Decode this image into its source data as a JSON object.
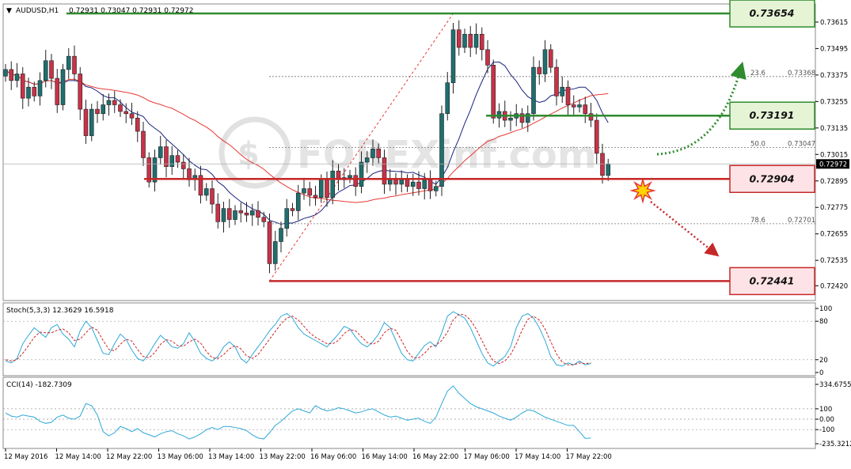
{
  "header": {
    "symbol_label": "AUDUSD,H1",
    "ohlc": "0.72931 0.73047 0.72931 0.72972"
  },
  "watermark": "FOREXinf.com",
  "colors": {
    "bull": "#1f6f6f",
    "bear": "#c83248",
    "ma_fast": "#1a237e",
    "ma_slow": "#e53935",
    "support_green": "#2e8b2e",
    "resistance_red": "#c62828",
    "green_box_fill": "#e6f4d6",
    "red_box_fill": "#fde3e6",
    "stoch_main": "#2fa8d8",
    "stoch_signal": "#cc2222",
    "cci": "#2fa8d8"
  },
  "chart_data": [
    {
      "type": "candlestick",
      "title": "AUDUSD,H1",
      "ylim": [
        0.7236,
        0.7369
      ],
      "y_ticks": [
        "0.73615",
        "0.73495",
        "0.73375",
        "0.73255",
        "0.73135",
        "0.73015",
        "0.72895",
        "0.72775",
        "0.72655",
        "0.72535",
        "0.72420"
      ],
      "current_price": "0.72972",
      "x_labels": [
        "12 May 2016",
        "12 May 14:00",
        "12 May 22:00",
        "13 May 06:00",
        "13 May 14:00",
        "13 May 22:00",
        "16 May 06:00",
        "16 May 14:00",
        "16 May 22:00",
        "17 May 06:00",
        "17 May 14:00",
        "17 May 22:00"
      ],
      "closes": [
        0.734,
        0.7335,
        0.7338,
        0.7327,
        0.7332,
        0.7328,
        0.7335,
        0.7344,
        0.7336,
        0.7324,
        0.734,
        0.7346,
        0.7338,
        0.7322,
        0.731,
        0.7322,
        0.732,
        0.7324,
        0.7326,
        0.7324,
        0.7321,
        0.732,
        0.7318,
        0.7312,
        0.73,
        0.7289,
        0.73,
        0.7305,
        0.7296,
        0.7301,
        0.7298,
        0.7295,
        0.729,
        0.7292,
        0.7283,
        0.7286,
        0.7279,
        0.7271,
        0.7277,
        0.7272,
        0.7276,
        0.7275,
        0.7274,
        0.7276,
        0.7273,
        0.7271,
        0.7252,
        0.7262,
        0.7268,
        0.7277,
        0.7276,
        0.7284,
        0.7286,
        0.7283,
        0.7282,
        0.729,
        0.7282,
        0.7294,
        0.729,
        0.7291,
        0.7292,
        0.7287,
        0.7298,
        0.73,
        0.7304,
        0.73,
        0.7288,
        0.729,
        0.7288,
        0.729,
        0.7287,
        0.7289,
        0.7286,
        0.729,
        0.7285,
        0.7287,
        0.732,
        0.7334,
        0.7358,
        0.735,
        0.7356,
        0.735,
        0.7356,
        0.7349,
        0.7342,
        0.7318,
        0.7321,
        0.7317,
        0.7318,
        0.732,
        0.7316,
        0.732,
        0.7341,
        0.7338,
        0.7349,
        0.7341,
        0.7328,
        0.7332,
        0.7324,
        0.7323,
        0.7324,
        0.732,
        0.7317,
        0.7302,
        0.7292,
        0.7297
      ],
      "overlays": [
        {
          "name": "MA fast",
          "role": "ma_fast"
        },
        {
          "name": "MA slow",
          "role": "ma_slow"
        }
      ],
      "levels": [
        {
          "label": "0.73654",
          "value": 0.73654,
          "color": "green"
        },
        {
          "label": "0.73191",
          "value": 0.73191,
          "color": "green"
        },
        {
          "label": "0.72904",
          "value": 0.72904,
          "color": "red"
        },
        {
          "label": "0.72441",
          "value": 0.72441,
          "color": "red"
        }
      ],
      "fibonacci": [
        {
          "ratio": "23.6",
          "price": "0.73368",
          "value": 0.73368
        },
        {
          "ratio": "50.0",
          "price": "0.73047",
          "value": 0.73047
        },
        {
          "ratio": "78.6",
          "price": "0.72701",
          "value": 0.72701
        }
      ],
      "annotations": [
        "green dotted arrow: upside continuation toward 0.73654",
        "red dotted arrow: breakdown below 0.72904 toward 0.72441",
        "burst marker at 0.72904 break"
      ]
    },
    {
      "type": "line",
      "title": "Stoch(5,3,3) 12.3629 16.5918",
      "ylim": [
        0,
        100
      ],
      "y_ticks": [
        "100",
        "80",
        "20",
        "0"
      ],
      "series": [
        {
          "name": "Stoch(5,3,3)",
          "role": "stoch_main",
          "values": [
            18,
            15,
            22,
            45,
            58,
            70,
            62,
            55,
            70,
            75,
            60,
            52,
            40,
            65,
            80,
            70,
            50,
            30,
            28,
            45,
            60,
            52,
            35,
            22,
            18,
            30,
            45,
            58,
            50,
            40,
            38,
            45,
            62,
            48,
            30,
            22,
            18,
            25,
            40,
            48,
            40,
            22,
            15,
            28,
            40,
            52,
            65,
            75,
            88,
            92,
            85,
            70,
            60,
            55,
            50,
            45,
            40,
            50,
            60,
            72,
            68,
            55,
            45,
            40,
            48,
            60,
            78,
            70,
            50,
            30,
            20,
            18,
            30,
            42,
            48,
            40,
            62,
            88,
            95,
            90,
            85,
            70,
            50,
            30,
            15,
            10,
            18,
            25,
            40,
            70,
            88,
            92,
            85,
            70,
            50,
            25,
            12,
            10,
            15,
            12,
            18,
            12,
            14
          ]
        },
        {
          "name": "Signal",
          "role": "stoch_signal",
          "values": [
            20,
            18,
            20,
            30,
            42,
            55,
            63,
            62,
            62,
            66,
            68,
            62,
            50,
            52,
            62,
            71,
            66,
            50,
            36,
            34,
            44,
            52,
            49,
            36,
            25,
            23,
            31,
            44,
            51,
            49,
            42,
            41,
            48,
            52,
            46,
            33,
            23,
            22,
            28,
            37,
            42,
            37,
            26,
            22,
            28,
            40,
            52,
            64,
            76,
            85,
            88,
            82,
            72,
            62,
            55,
            50,
            45,
            45,
            50,
            61,
            67,
            65,
            56,
            47,
            44,
            49,
            62,
            69,
            66,
            50,
            33,
            23,
            23,
            30,
            40,
            43,
            50,
            63,
            82,
            91,
            90,
            82,
            68,
            50,
            32,
            18,
            14,
            18,
            28,
            45,
            66,
            83,
            88,
            82,
            68,
            48,
            29,
            16,
            12,
            12,
            15,
            14,
            15
          ]
        }
      ]
    },
    {
      "type": "line",
      "title": "CCI(14) -182.7309",
      "ylim": [
        -235.3212,
        334.6755
      ],
      "y_ticks": [
        "334.6755",
        "100",
        "0.00",
        "-100",
        "-235.3212"
      ],
      "series": [
        {
          "name": "CCI(14)",
          "role": "cci",
          "values": [
            60,
            30,
            20,
            40,
            30,
            20,
            -20,
            -40,
            -30,
            20,
            40,
            10,
            0,
            30,
            150,
            130,
            40,
            -120,
            -160,
            -130,
            -70,
            -90,
            -120,
            -90,
            -130,
            -150,
            -170,
            -140,
            -120,
            -110,
            -140,
            -160,
            -190,
            -170,
            -140,
            -100,
            -80,
            -100,
            -70,
            -70,
            -80,
            -90,
            -110,
            -150,
            -180,
            -190,
            -130,
            -60,
            -20,
            30,
            80,
            100,
            80,
            60,
            130,
            100,
            80,
            90,
            110,
            100,
            80,
            60,
            70,
            90,
            100,
            70,
            40,
            20,
            30,
            10,
            -10,
            0,
            10,
            -20,
            -40,
            20,
            150,
            270,
            320,
            250,
            200,
            150,
            120,
            100,
            80,
            60,
            30,
            10,
            -10,
            20,
            60,
            90,
            80,
            50,
            20,
            0,
            -20,
            -40,
            -60,
            -60,
            -120,
            -185,
            -180
          ]
        }
      ]
    }
  ]
}
